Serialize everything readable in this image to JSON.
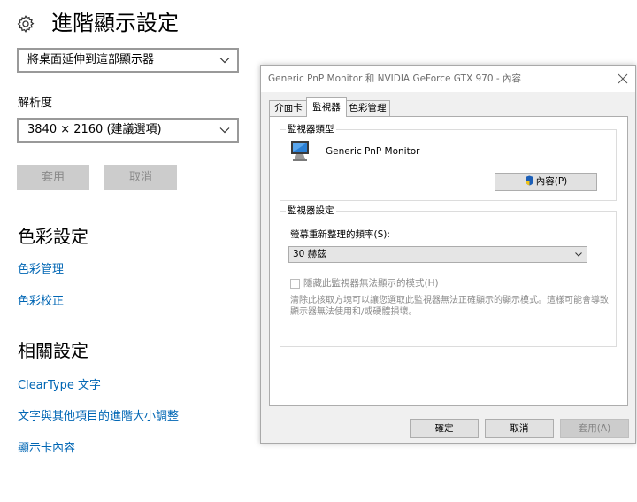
{
  "settings": {
    "title": "進階顯示設定",
    "display_select_value": "將桌面延伸到這部顯示器",
    "resolution_label": "解析度",
    "resolution_value": "3840 × 2160 (建議選項)",
    "apply_label": "套用",
    "cancel_label": "取消",
    "color_heading": "色彩設定",
    "color_management": "色彩管理",
    "color_calibration": "色彩校正",
    "related_heading": "相關設定",
    "cleartype": "ClearType 文字",
    "advanced_sizing": "文字與其他項目的進階大小調整",
    "adapter_properties": "顯示卡內容"
  },
  "dialog": {
    "title": "Generic PnP Monitor 和 NVIDIA GeForce GTX 970 - 內容",
    "tabs": [
      {
        "label": "介面卡"
      },
      {
        "label": "監視器",
        "selected": true
      },
      {
        "label": "色彩管理"
      }
    ],
    "monitor_type": {
      "label": "監視器類型",
      "monitor_name": "Generic PnP Monitor",
      "properties_button": "內容(P)"
    },
    "monitor_settings": {
      "label": "監視器設定",
      "refresh_label": "螢幕重新整理的頻率(S):",
      "refresh_value": "30 赫茲",
      "hide_modes_label": "隱藏此監視器無法顯示的模式(H)",
      "hide_modes_checked": false,
      "hint": "清除此核取方塊可以讓您選取此監視器無法正確顯示的顯示模式。這樣可能會導致顯示器無法使用和/或硬體損壞。"
    },
    "buttons": {
      "ok": "確定",
      "cancel": "取消",
      "apply": "套用(A)"
    }
  },
  "colors": {
    "link": "#0066b4",
    "disabled_button": "#cccccc",
    "dialog_bg": "#f0f0f0"
  },
  "icons": [
    "gear-icon",
    "chevron-down-icon",
    "close-icon",
    "monitor-icon",
    "uac-shield-icon"
  ]
}
